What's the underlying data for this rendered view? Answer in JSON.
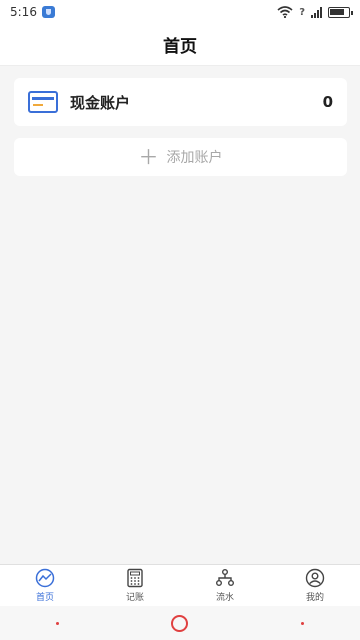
{
  "status_bar": {
    "time": "5:16",
    "network_label": "3G"
  },
  "header": {
    "title": "首页"
  },
  "account": {
    "name": "现金账户",
    "balance": "0",
    "icon": "card-icon"
  },
  "add_account": {
    "label": "添加账户",
    "icon": "plus-icon"
  },
  "tabs": [
    {
      "label": "首页",
      "icon": "chart-icon",
      "active": true
    },
    {
      "label": "记账",
      "icon": "calculator-icon",
      "active": false
    },
    {
      "label": "流水",
      "icon": "flow-icon",
      "active": false
    },
    {
      "label": "我的",
      "icon": "profile-icon",
      "active": false
    }
  ],
  "colors": {
    "accent": "#3a6fd8",
    "background": "#f5f5f5",
    "card": "#ffffff",
    "muted_text": "#a8a8a8",
    "system_nav": "#e04040"
  }
}
